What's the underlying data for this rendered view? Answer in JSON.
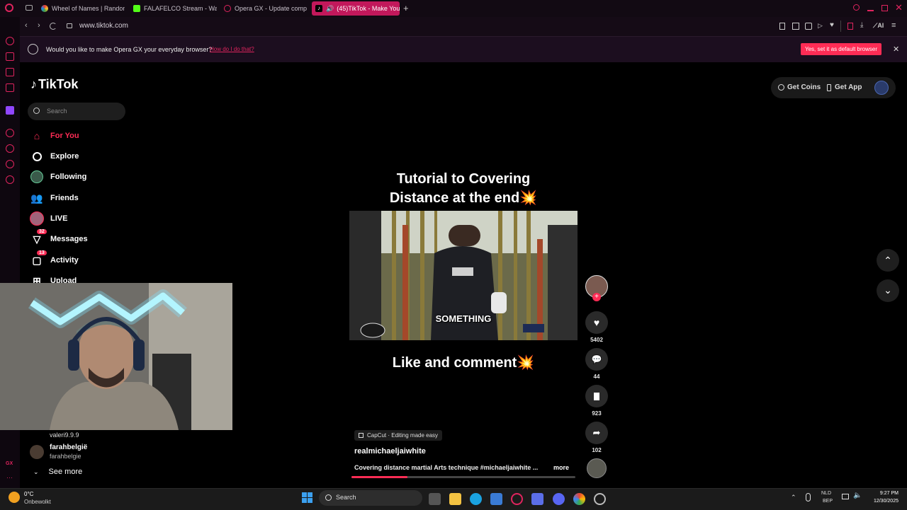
{
  "browser": {
    "tabs": [
      {
        "title": "Wheel of Names | Randon",
        "active": false
      },
      {
        "title": "FALAFELCO Stream - Wat",
        "active": false
      },
      {
        "title": "Opera GX - Update comp",
        "active": false
      },
      {
        "title": "(45)TikTok - Make You",
        "active": true
      }
    ],
    "new_tab_label": "+",
    "url": "www.tiktok.com",
    "address_ai_label": "AI"
  },
  "banner": {
    "message": "Would you like to make Opera GX your everyday browser?",
    "link": "How do I do that?",
    "cta": "Yes, set it as default browser",
    "close": "✕"
  },
  "tiktok": {
    "logo": "TikTok",
    "search_placeholder": "Search",
    "nav": [
      {
        "label": "For You",
        "icon": "home-icon",
        "active": true
      },
      {
        "label": "Explore",
        "icon": "compass-icon"
      },
      {
        "label": "Following",
        "icon": "following-icon"
      },
      {
        "label": "Friends",
        "icon": "friends-icon"
      },
      {
        "label": "LIVE",
        "icon": "live-icon"
      },
      {
        "label": "Messages",
        "icon": "messages-icon",
        "badge": "32"
      },
      {
        "label": "Activity",
        "icon": "activity-icon",
        "badge": "13"
      },
      {
        "label": "Upload",
        "icon": "upload-icon"
      }
    ],
    "following_accounts": [
      {
        "name": "valeri9.9.9"
      },
      {
        "name": "farahbelgië",
        "handle": "farahbelgie"
      }
    ],
    "see_more": "See more",
    "top_right": {
      "coins": "Get Coins",
      "app": "Get App"
    },
    "video": {
      "title_line1": "Tutorial to Covering",
      "title_line2": "Distance at the end💥",
      "caption_overlay": "SOMETHING",
      "bottom_text": "Like and comment💥",
      "capcut": "CapCut · Editing made easy",
      "author": "realmichaeljaiwhite",
      "description": "Covering distance martial Arts technique #michaeljaiwhite ...",
      "more": "more",
      "progress": 0.25
    },
    "actions": {
      "likes": "5402",
      "comments": "44",
      "saves": "923",
      "shares": "102"
    }
  },
  "taskbar": {
    "weather_temp": "0°C",
    "weather_desc": "Onbewolkt",
    "search": "Search",
    "lang1": "NLD",
    "lang2": "BEP",
    "time": "9:27 PM",
    "date": "12/30/2025"
  },
  "colors": {
    "accent": "#fe2c55",
    "opera": "#e0245e",
    "bg": "#000000"
  }
}
